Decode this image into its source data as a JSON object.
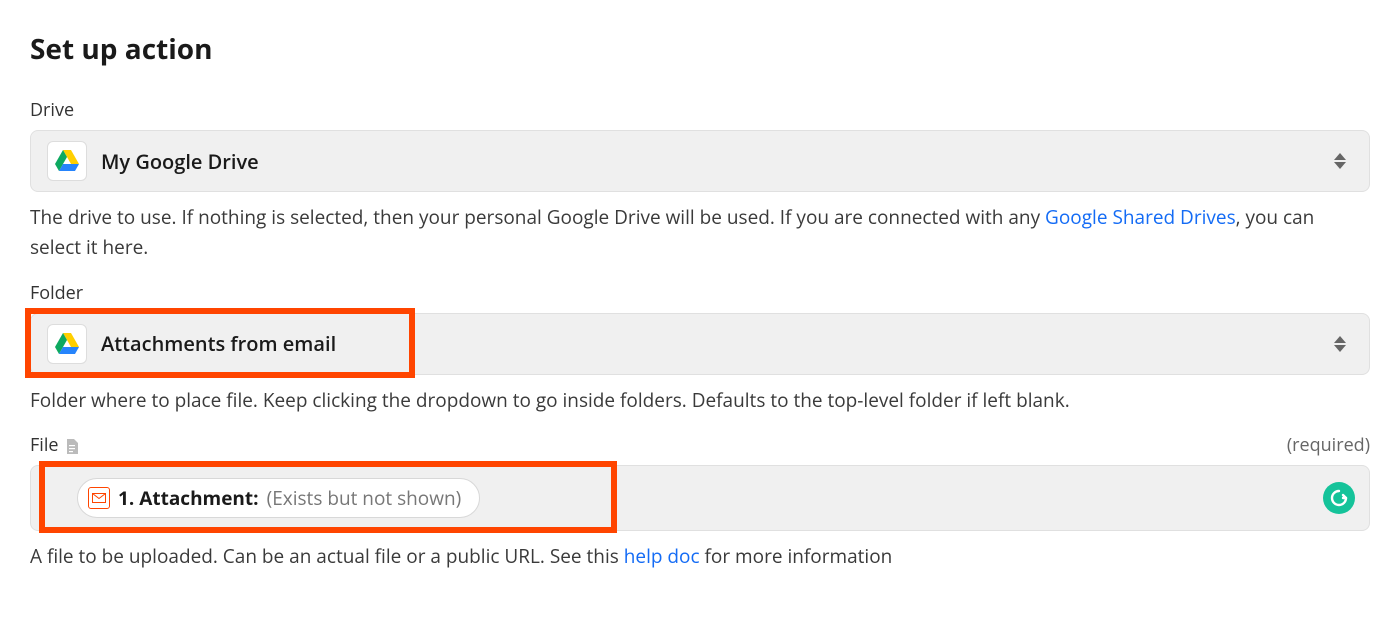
{
  "title": "Set up action",
  "drive": {
    "label": "Drive",
    "value": "My Google Drive",
    "help_pre": "The drive to use. If nothing is selected, then your personal Google Drive will be used. If you are connected with any ",
    "help_link": "Google Shared Drives",
    "help_post": ", you can select it here."
  },
  "folder": {
    "label": "Folder",
    "value": "Attachments from email",
    "help": "Folder where to place file. Keep clicking the dropdown to go inside folders. Defaults to the top-level folder if left blank."
  },
  "file": {
    "label": "File",
    "required": "(required)",
    "pill_prefix": "1. Attachment:",
    "pill_suffix": "(Exists but not shown)",
    "help_pre": "A file to be uploaded. Can be an actual file or a public URL. See this ",
    "help_link": "help doc",
    "help_post": " for more information"
  }
}
